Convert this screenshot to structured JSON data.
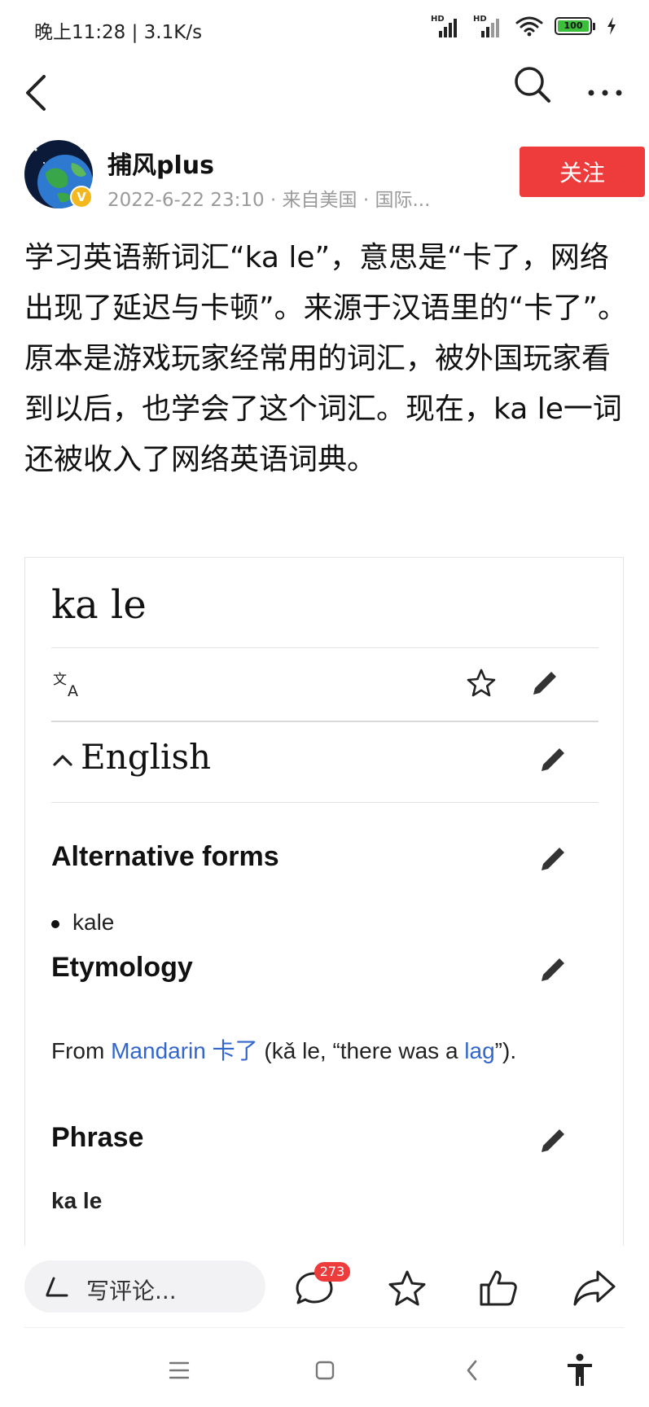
{
  "status_bar": {
    "time_speed": "晚上11:28 | 3.1K/s",
    "signal_1_label": "HD",
    "signal_2_label": "HD",
    "battery_level": "100"
  },
  "nav": {
    "back_icon": "chevron-left",
    "search_icon": "search",
    "more_icon": "more-horizontal"
  },
  "author": {
    "name": "捕风plus",
    "meta": "2022-6-22 23:10 · 来自美国 · 国际...",
    "verified_badge": "V",
    "follow_label": "关注"
  },
  "post": {
    "text": "学习英语新词汇“ka le”，意思是“卡了，网络出现了延迟与卡顿”。来源于汉语里的“卡了”。原本是游戏玩家经常用的词汇，被外国玩家看到以后，也学会了这个词汇。现在，ka le一词还被收入了网络英语词典。"
  },
  "wiki": {
    "title": "ka le",
    "language_heading": "English",
    "alt_forms_heading": "Alternative forms",
    "alt_forms": [
      "kale"
    ],
    "etymology_heading": "Etymology",
    "etymology": {
      "prefix": "From ",
      "link_1": "Mandarin",
      "middle_1": " ",
      "link_2": "卡了",
      "middle_2": " (kǎ le, “there was a ",
      "link_3": "lag",
      "suffix": "”)."
    },
    "phrase_heading": "Phrase",
    "phrase_term": "ka le"
  },
  "bottom_bar": {
    "comment_placeholder": "写评论...",
    "comment_count": "273"
  },
  "colors": {
    "accent_red": "#ee3b3b",
    "link_blue": "#3366cc",
    "meta_gray": "#9a9a9a"
  }
}
